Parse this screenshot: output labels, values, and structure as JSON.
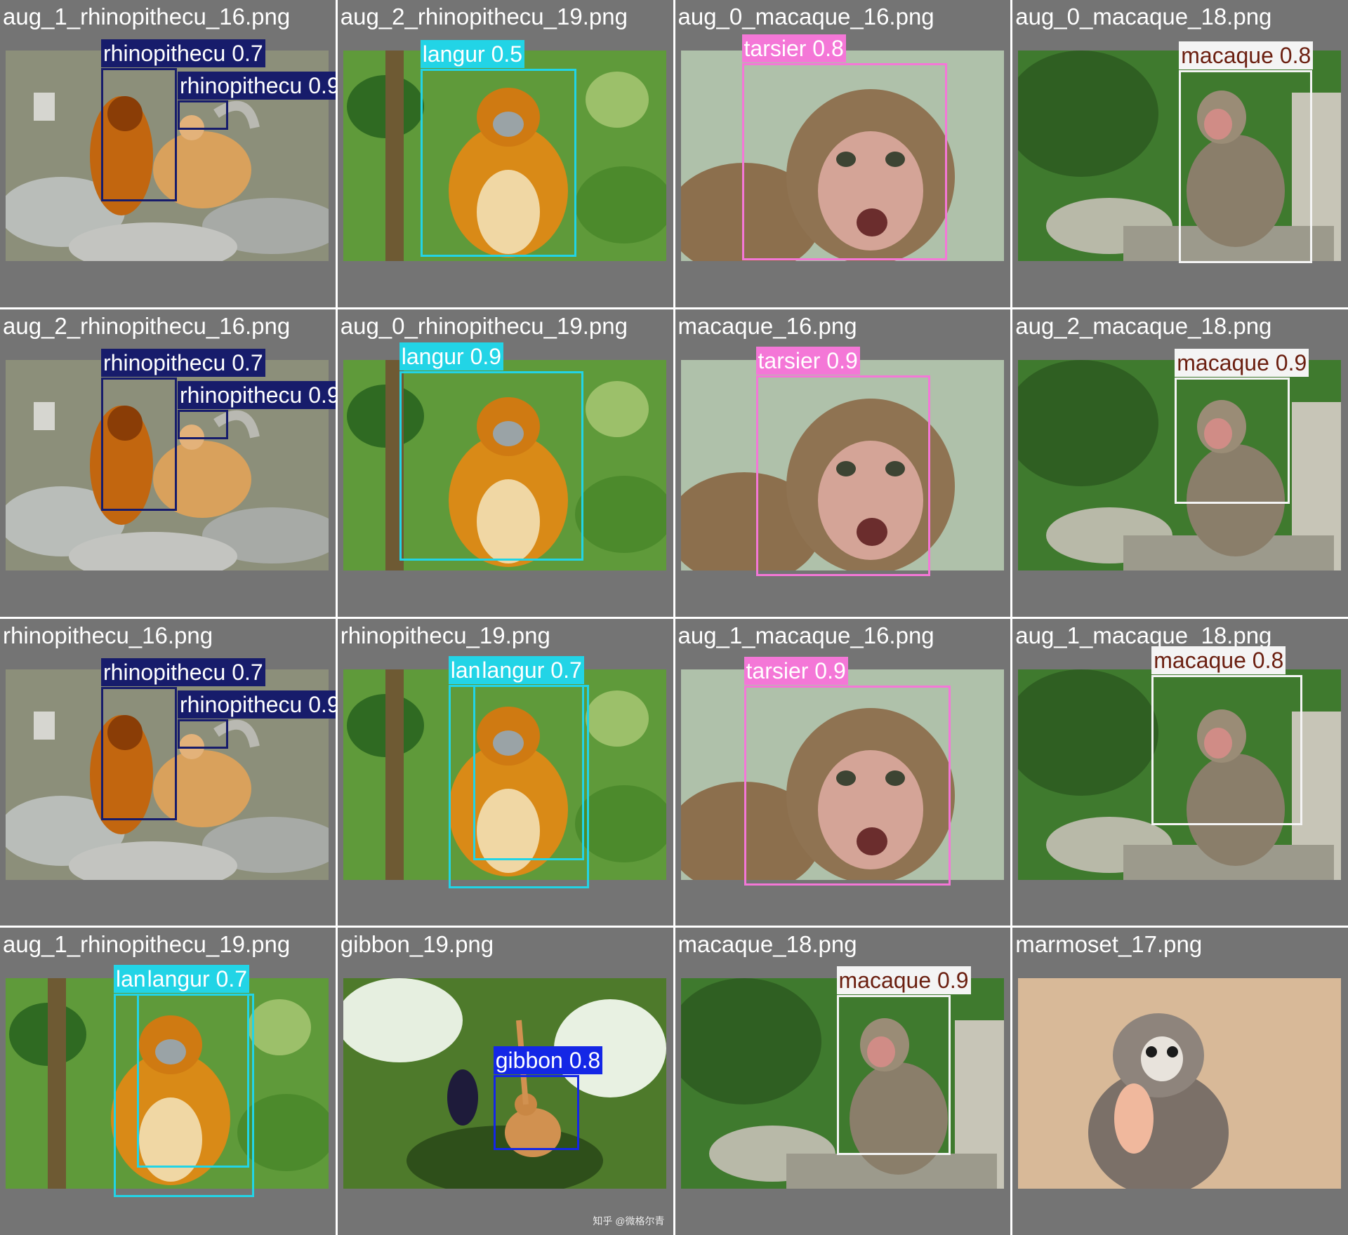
{
  "colors": {
    "rhinopithecu": "#171c6b",
    "langur": "#22d4e6",
    "tarsier": "#f477d7",
    "macaque": "#f4f4f4",
    "gibbon": "#1427e6",
    "cell_background": "#747474"
  },
  "cells": [
    {
      "title": "aug_1_rhinopithecu_16.png",
      "photo": "rhino",
      "labels": [
        "rhinopithecu 0.7",
        "rhinopithecu 0.9"
      ]
    },
    {
      "title": "aug_2_rhinopithecu_19.png",
      "photo": "langur",
      "labels": [
        "langur 0.5"
      ]
    },
    {
      "title": "aug_0_macaque_16.png",
      "photo": "tarsier",
      "labels": [
        "tarsier 0.8"
      ]
    },
    {
      "title": "aug_0_macaque_18.png",
      "photo": "macaque",
      "labels": [
        "macaque 0.8"
      ]
    },
    {
      "title": "aug_2_rhinopithecu_16.png",
      "photo": "rhino",
      "labels": [
        "rhinopithecu 0.7",
        "rhinopithecu 0.9"
      ]
    },
    {
      "title": "aug_0_rhinopithecu_19.png",
      "photo": "langur",
      "labels": [
        "langur 0.9"
      ]
    },
    {
      "title": "macaque_16.png",
      "photo": "tarsier",
      "labels": [
        "tarsier 0.9"
      ]
    },
    {
      "title": "aug_2_macaque_18.png",
      "photo": "macaque",
      "labels": [
        "macaque 0.9"
      ]
    },
    {
      "title": "rhinopithecu_16.png",
      "photo": "rhino",
      "labels": [
        "rhinopithecu 0.7",
        "rhinopithecu 0.9"
      ]
    },
    {
      "title": "rhinopithecu_19.png",
      "photo": "langur",
      "labels": [
        "langur 0.3",
        "langur 0.7"
      ]
    },
    {
      "title": "aug_1_macaque_16.png",
      "photo": "tarsier",
      "labels": [
        "tarsier 0.9"
      ]
    },
    {
      "title": "aug_1_macaque_18.png",
      "photo": "macaque",
      "labels": [
        "macaque 0.8"
      ]
    },
    {
      "title": "aug_1_rhinopithecu_19.png",
      "photo": "langur",
      "labels": [
        "langur 0.3",
        "langur 0.7"
      ]
    },
    {
      "title": "gibbon_19.png",
      "photo": "gibbon",
      "labels": [
        "gibbon 0.8"
      ],
      "watermark": "知乎 @微格尔青"
    },
    {
      "title": "macaque_18.png",
      "photo": "macaque",
      "labels": [
        "macaque 0.9"
      ]
    },
    {
      "title": "marmoset_17.png",
      "photo": "marmoset",
      "labels": []
    }
  ]
}
